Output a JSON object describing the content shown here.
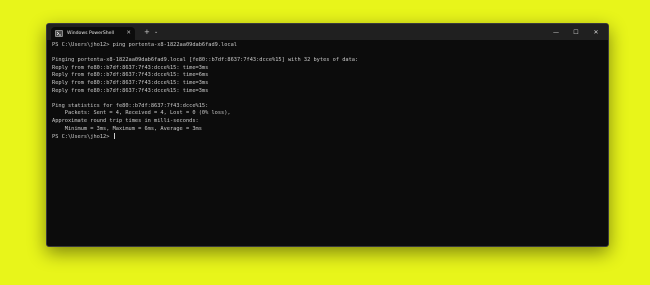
{
  "window": {
    "tab_title": "Windows PowerShell",
    "tab_close": "✕",
    "new_tab": "+",
    "dropdown": "⌄",
    "minimize": "—",
    "maximize": "☐",
    "close": "✕"
  },
  "terminal": {
    "lines": [
      "PS C:\\Users\\jho12> ping portenta-x8-1822aa09dab6fad9.local",
      "",
      "Pinging portenta-x8-1822aa09dab6fad9.local [fe80::b7df:8637:7f43:dcce%15] with 32 bytes of data:",
      "Reply from fe80::b7df:8637:7f43:dcce%15: time=3ms",
      "Reply from fe80::b7df:8637:7f43:dcce%15: time=6ms",
      "Reply from fe80::b7df:8637:7f43:dcce%15: time=3ms",
      "Reply from fe80::b7df:8637:7f43:dcce%15: time=3ms",
      "",
      "Ping statistics for fe80::b7df:8637:7f43:dcce%15:",
      "    Packets: Sent = 4, Received = 4, Lost = 0 (0% loss),",
      "Approximate round trip times in milli-seconds:",
      "    Minimum = 3ms, Maximum = 6ms, Average = 3ms"
    ],
    "prompt": "PS C:\\Users\\jho12> "
  },
  "colors": {
    "background": "#e8f51a",
    "terminal_bg": "#0c0c0c",
    "titlebar_bg": "#202020",
    "text": "#cccccc"
  }
}
